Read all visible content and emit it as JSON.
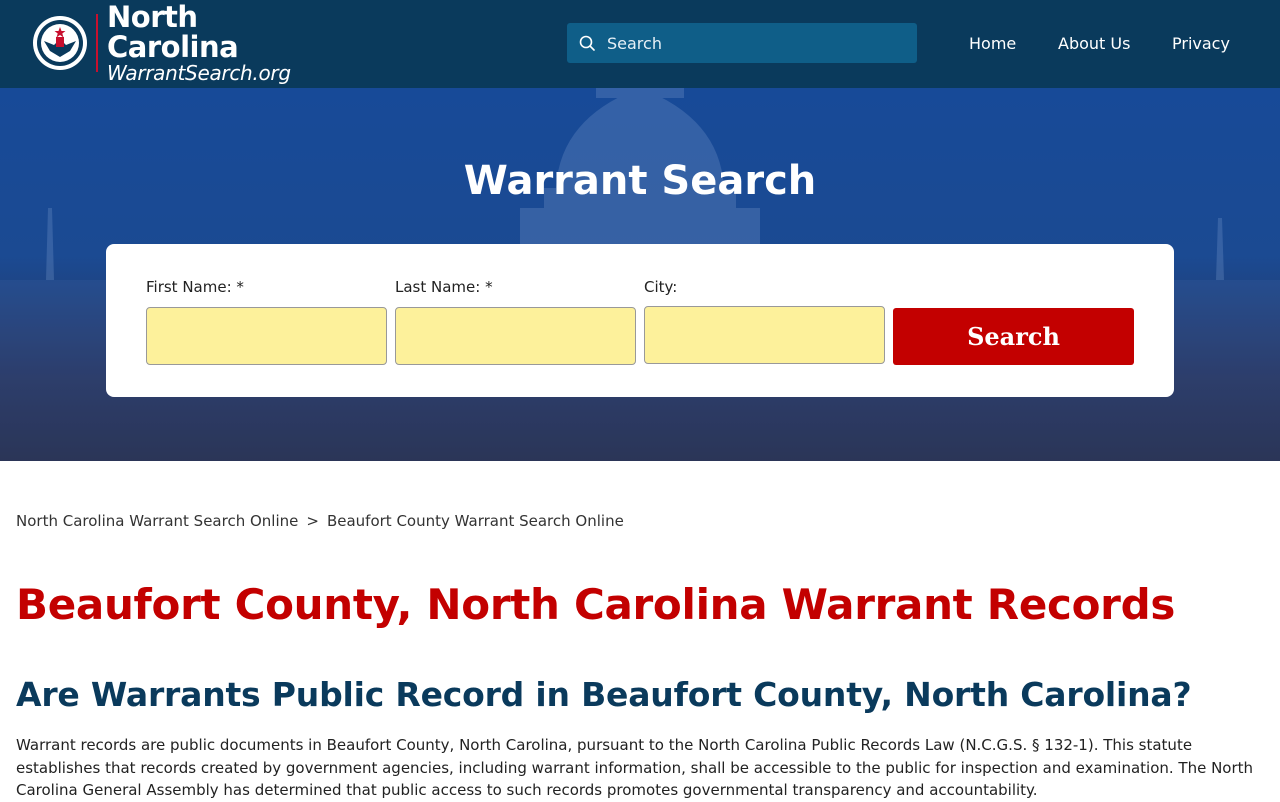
{
  "header": {
    "logo": {
      "line1": "North",
      "line2": "Carolina",
      "line3": "WarrantSearch.org",
      "seal_text": "WARRANT SEARCH",
      "icon": "eagle-seal-icon"
    },
    "search": {
      "placeholder": "Search",
      "icon": "search-icon"
    },
    "nav": {
      "home": "Home",
      "about": "About Us",
      "privacy": "Privacy"
    },
    "colors": {
      "bar": "#0a3a5c",
      "search_bg": "#0f5e88",
      "accent": "#c8102e"
    }
  },
  "hero": {
    "title": "Warrant Search",
    "form": {
      "first_name_label": "First Name: *",
      "last_name_label": "Last Name: *",
      "city_label": "City:",
      "first_name_value": "",
      "last_name_value": "",
      "city_value": "",
      "submit_label": "Search"
    },
    "colors": {
      "input_bg": "#fdf19b",
      "button_bg": "#c30000"
    }
  },
  "breadcrumb": {
    "items": [
      "North Carolina Warrant Search Online",
      "Beaufort County Warrant Search Online"
    ],
    "separator": ">"
  },
  "main": {
    "page_title": "Beaufort County, North Carolina Warrant Records",
    "section_heading": "Are Warrants Public Record in Beaufort County, North Carolina?",
    "paragraph": "Warrant records are public documents in Beaufort County, North Carolina, pursuant to the North Carolina Public Records Law (N.C.G.S. § 132-1). This statute establishes that records created by government agencies, including warrant information, shall be accessible to the public for inspection and examination. The North Carolina General Assembly has determined that public access to such records promotes governmental transparency and accountability.",
    "colors": {
      "title": "#c30000",
      "heading": "#0a3a5c"
    }
  }
}
